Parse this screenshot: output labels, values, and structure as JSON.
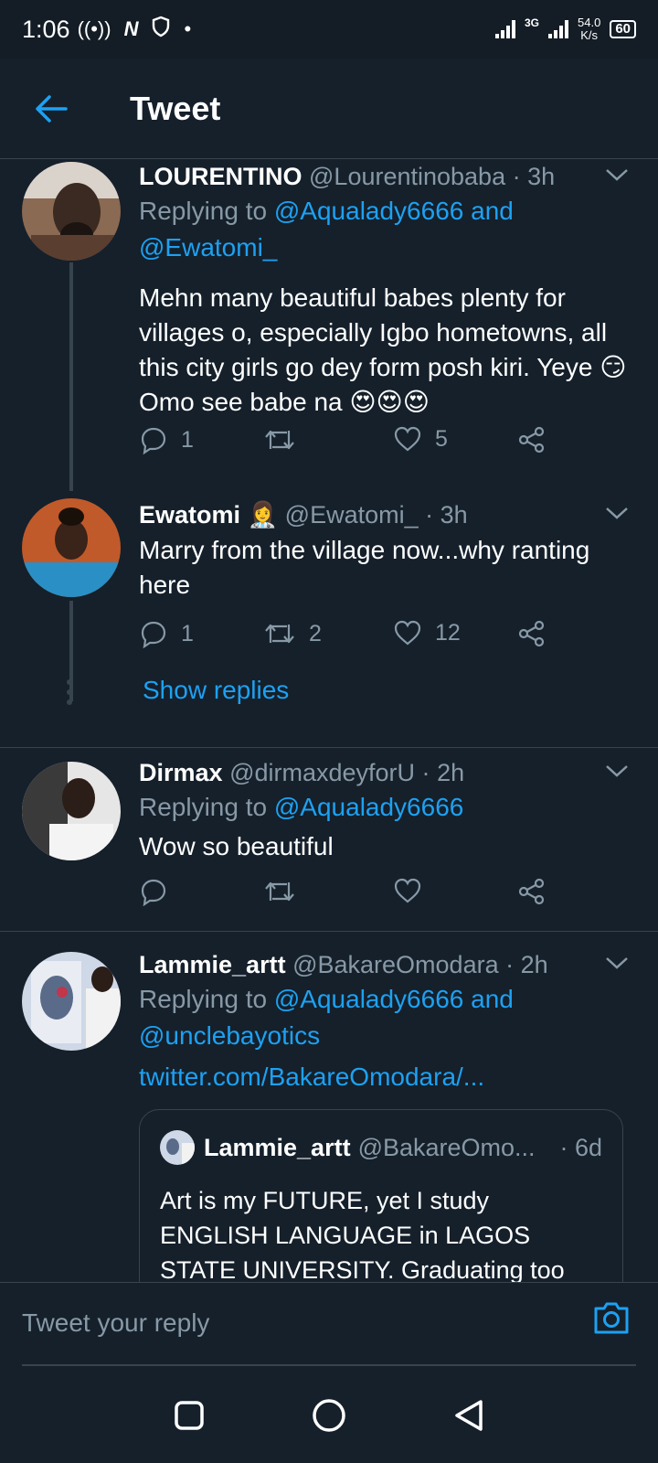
{
  "status_bar": {
    "time": "1:06",
    "network_type": "3G",
    "speed_value": "54.0",
    "speed_unit": "K/s",
    "battery": "60"
  },
  "header": {
    "title": "Tweet"
  },
  "tweets": [
    {
      "name": "LOURENTINO",
      "handle": "@Lourentinobaba",
      "time": "3h",
      "replying_prefix": "Replying to",
      "replying_line1": "@Aqualady6666 and",
      "replying_line2": "@Ewatomi_",
      "text": "Mehn many beautiful babes plenty for villages o, especially Igbo hometowns, all this city girls go dey form posh kiri. Yeye 😏 Omo see babe na 😍😍😍",
      "replies": "1",
      "retweets": "",
      "likes": "5"
    },
    {
      "name": "Ewatomi 👩‍⚕️",
      "handle": "@Ewatomi_",
      "time": "3h",
      "text": "Marry from the village now...why ranting here",
      "replies": "1",
      "retweets": "2",
      "likes": "12",
      "show_replies": "Show replies"
    },
    {
      "name": "Dirmax",
      "handle": "@dirmaxdeyforU",
      "time": "2h",
      "replying_prefix": "Replying to",
      "replying_line1": "@Aqualady6666",
      "text": "Wow so beautiful",
      "replies": "",
      "retweets": "",
      "likes": ""
    },
    {
      "name": "Lammie_artt",
      "handle": "@BakareOmodara",
      "time": "2h",
      "replying_prefix": "Replying to",
      "replying_line1": "@Aqualady6666 and",
      "replying_line2": "@unclebayotics",
      "link": "twitter.com/BakareOmodara/...",
      "quote": {
        "name": "Lammie_artt",
        "handle": "@BakareOmo...",
        "time": "· 6d",
        "text": "Art is my FUTURE, yet I study ENGLISH LANGUAGE in LAGOS STATE UNIVERSITY. Graduating too"
      }
    }
  ],
  "reply_bar": {
    "placeholder": "Tweet your reply"
  },
  "icons": {
    "back": "arrow-left-icon",
    "chevron": "chevron-down-icon",
    "reply": "reply-icon",
    "retweet": "retweet-icon",
    "like": "heart-icon",
    "share": "share-icon",
    "camera": "camera-icon"
  },
  "colors": {
    "background": "#15202b",
    "accent": "#1da1f2",
    "muted": "#8899a6",
    "divider": "#38444d"
  }
}
